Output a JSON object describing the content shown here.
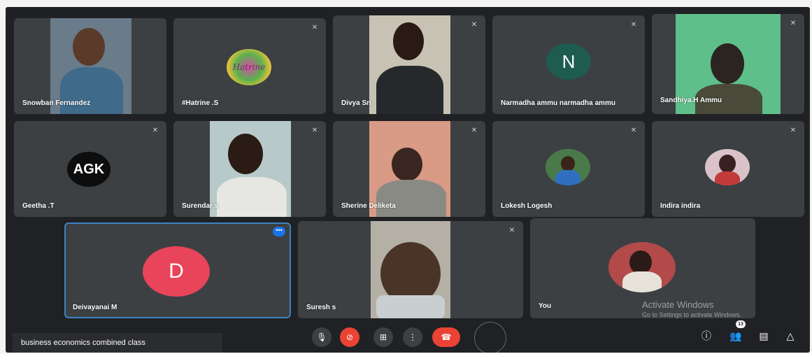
{
  "participants": [
    {
      "name": "Snowban Fernandez",
      "type": "video",
      "muted": false
    },
    {
      "name": "#Hatrine .S",
      "type": "logo",
      "logo_text": "Hatrine",
      "muted": true
    },
    {
      "name": "Divya Sri",
      "type": "video",
      "muted": true
    },
    {
      "name": "Narmadha ammu narmadha ammu",
      "type": "letter",
      "letter": "N",
      "color": "#1e5c4f",
      "muted": true
    },
    {
      "name": "Sandhiya.H Ammu",
      "type": "video",
      "muted": true
    },
    {
      "name": "Geetha .T",
      "type": "logo",
      "logo_text": "AGK",
      "muted": true
    },
    {
      "name": "Surendar s",
      "type": "video",
      "muted": true
    },
    {
      "name": "Sherine Deliketa",
      "type": "video",
      "muted": true
    },
    {
      "name": "Lokesh Logesh",
      "type": "photo",
      "muted": true
    },
    {
      "name": "Indira indira",
      "type": "photo",
      "muted": true
    },
    {
      "name": "Deivayanai M",
      "type": "letter",
      "letter": "D",
      "color": "#e8445a",
      "active": true,
      "more": "•••"
    },
    {
      "name": "Suresh s",
      "type": "video",
      "muted": true
    },
    {
      "name": "You",
      "type": "photo"
    }
  ],
  "meeting_title": "business economics combined class",
  "controls": {
    "mic": "mic-icon",
    "camera": "camera-off-icon",
    "present": "present-icon",
    "more": "more-vert-icon",
    "hangup": "hangup-icon"
  },
  "right_controls": {
    "info": "info-icon",
    "people": "people-icon",
    "people_count": "13",
    "chat": "chat-icon",
    "activities": "activities-icon"
  },
  "watermark": {
    "line1": "Activate Windows",
    "line2": "Go to Settings to activate Windows."
  },
  "colors": {
    "background": "#202124",
    "tile": "#3c4043",
    "hangup": "#ea4335",
    "active_border": "#3b82c4"
  }
}
